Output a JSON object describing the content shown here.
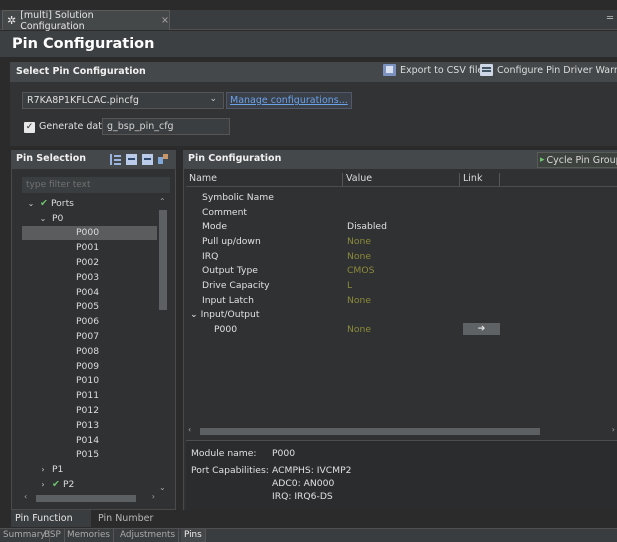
{
  "editor_tab": {
    "title": "[multi] Solution Configuration",
    "close": "×"
  },
  "window_controls": "═",
  "page_title": "Pin Configuration",
  "select_section": {
    "title": "Select Pin Configuration",
    "export_label": "Export to CSV file",
    "configure_label": "Configure Pin Driver Warnings",
    "config_file": "R7KA8P1KFLCAC.pincfg",
    "manage_link": "Manage configurations...",
    "generate_label": "Generate data:",
    "generate_value": "g_bsp_pin_cfg",
    "generate_checked": true
  },
  "pin_selection": {
    "title": "Pin Selection",
    "filter_placeholder": "type filter text",
    "tree": [
      {
        "label": "Ports",
        "indent": 0,
        "expanded": true,
        "checked": true
      },
      {
        "label": "P0",
        "indent": 1,
        "expanded": true,
        "checked": false
      },
      {
        "label": "P000",
        "indent": 2,
        "selected": true
      },
      {
        "label": "P001",
        "indent": 2
      },
      {
        "label": "P002",
        "indent": 2
      },
      {
        "label": "P003",
        "indent": 2
      },
      {
        "label": "P004",
        "indent": 2
      },
      {
        "label": "P005",
        "indent": 2
      },
      {
        "label": "P006",
        "indent": 2
      },
      {
        "label": "P007",
        "indent": 2
      },
      {
        "label": "P008",
        "indent": 2
      },
      {
        "label": "P009",
        "indent": 2
      },
      {
        "label": "P010",
        "indent": 2
      },
      {
        "label": "P011",
        "indent": 2
      },
      {
        "label": "P012",
        "indent": 2
      },
      {
        "label": "P013",
        "indent": 2
      },
      {
        "label": "P014",
        "indent": 2
      },
      {
        "label": "P015",
        "indent": 2
      },
      {
        "label": "P1",
        "indent": 1,
        "expanded": false,
        "checked": false
      },
      {
        "label": "P2",
        "indent": 1,
        "expanded": false,
        "checked": true
      }
    ]
  },
  "pin_config": {
    "title": "Pin Configuration",
    "cycle_label": "Cycle Pin Group",
    "columns": [
      "Name",
      "Value",
      "Link"
    ],
    "rows": [
      {
        "name": "Symbolic Name",
        "value": "",
        "style": "normal"
      },
      {
        "name": "Comment",
        "value": "",
        "style": "normal"
      },
      {
        "name": "Mode",
        "value": "Disabled",
        "style": "normal"
      },
      {
        "name": "Pull up/down",
        "value": "None",
        "style": "default"
      },
      {
        "name": "IRQ",
        "value": "None",
        "style": "default"
      },
      {
        "name": "Output Type",
        "value": "CMOS",
        "style": "default"
      },
      {
        "name": "Drive Capacity",
        "value": "L",
        "style": "default"
      },
      {
        "name": "Input Latch",
        "value": "None",
        "style": "default"
      },
      {
        "name": "Input/Output",
        "value": "",
        "style": "group"
      },
      {
        "name": "P000",
        "value": "None",
        "style": "default-indent",
        "link": "➔"
      }
    ],
    "module_label": "Module name:",
    "module_value": "P000",
    "caps_label": "Port Capabilities:",
    "caps": [
      "ACMPHS: IVCMP2",
      "ADC0: AN000",
      "IRQ: IRQ6-DS"
    ]
  },
  "bottom_tabs": {
    "pin_function": "Pin Function",
    "pin_number": "Pin Number"
  },
  "status_tabs": [
    "Summary",
    "BSP",
    "Memories",
    "Adjustments",
    "Pins"
  ]
}
